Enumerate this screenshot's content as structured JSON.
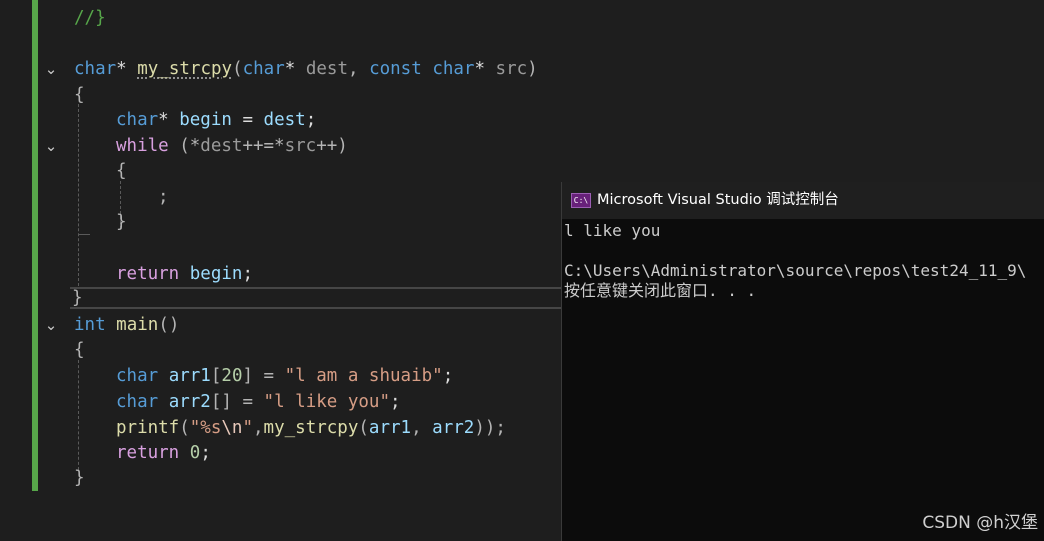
{
  "editor": {
    "lines": {
      "l0": {
        "cmt": "//}"
      },
      "l1": {
        "t1": "char",
        "t2": "* ",
        "t3": "my_strcpy",
        "t4": "(",
        "t5": "char",
        "t6": "* ",
        "t7": "dest",
        "t8": ", ",
        "t9": "const",
        "t10": " ",
        "t11": "char",
        "t12": "* ",
        "t13": "src",
        "t14": ")"
      },
      "l2": {
        "t1": "{"
      },
      "l3": {
        "t1": "char",
        "t2": "* ",
        "t3": "begin",
        "t4": " = ",
        "t5": "dest",
        "t6": ";"
      },
      "l4": {
        "t1": "while",
        "t2": " (*",
        "t3": "dest",
        "t4": "++=*",
        "t5": "src",
        "t6": "++)"
      },
      "l5": {
        "t1": "{"
      },
      "l6": {
        "t1": ";"
      },
      "l7": {
        "t1": "}"
      },
      "l8": {
        "t1": "return",
        "t2": " ",
        "t3": "begin",
        "t4": ";"
      },
      "l9": {
        "t1": "}"
      },
      "l10": {
        "t1": "int",
        "t2": " ",
        "t3": "main",
        "t4": "()"
      },
      "l11": {
        "t1": "{"
      },
      "l12": {
        "t1": "char",
        "t2": " ",
        "t3": "arr1",
        "t4": "[",
        "t5": "20",
        "t6": "] = ",
        "t7": "\"l am a shuaib\"",
        "t8": ";"
      },
      "l13": {
        "t1": "char",
        "t2": " ",
        "t3": "arr2",
        "t4": "[] = ",
        "t5": "\"l like you\"",
        "t6": ";"
      },
      "l14": {
        "t1": "printf",
        "t2": "(",
        "t3": "\"%s",
        "t4": "\\n",
        "t5": "\"",
        "t6": ",",
        "t7": "my_strcpy",
        "t8": "(",
        "t9": "arr1",
        "t10": ", ",
        "t11": "arr2",
        "t12": "));"
      },
      "l15": {
        "t1": "return",
        "t2": " ",
        "t3": "0",
        "t4": ";"
      },
      "l16": {
        "t1": "}"
      }
    }
  },
  "console": {
    "title": "Microsoft Visual Studio 调试控制台",
    "icon_text": "C:\\",
    "output": [
      "l like you",
      "",
      "C:\\Users\\Administrator\\source\\repos\\test24_11_9\\",
      "按任意键关闭此窗口. . ."
    ]
  },
  "watermark": "CSDN @h汉堡",
  "colors": {
    "editor_bg": "#1e1e1e",
    "keyword": "#569cd6",
    "control": "#d8a0df",
    "function": "#dcdcaa",
    "string": "#d69d85",
    "comment": "#57a64a",
    "console_bg": "#0c0c0c"
  }
}
